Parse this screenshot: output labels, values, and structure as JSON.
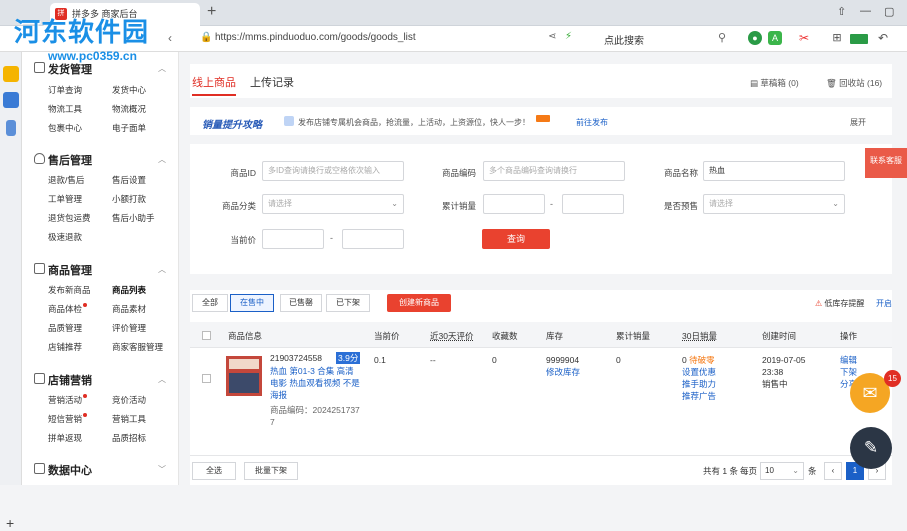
{
  "browser": {
    "tab_title": "拼多多 商家后台",
    "new_tab": "+",
    "url": "https://mms.pinduoduo.com/goods/goods_list",
    "search_hint": "点此搜索",
    "win_pin": "⇧",
    "win_min": "—",
    "win_max": "▢"
  },
  "watermark": {
    "title": "河东软件园",
    "url": "www.pc0359.cn"
  },
  "sidebar": {
    "sections": [
      {
        "title": "发货管理",
        "items": [
          "订单查询",
          "发货中心",
          "物流工具",
          "物流概况",
          "包裹中心",
          "电子面单"
        ]
      },
      {
        "title": "售后管理",
        "items": [
          "退款/售后",
          "售后设置",
          "工单管理",
          "小额打款",
          "退货包运费",
          "售后小助手",
          "极速退款"
        ]
      },
      {
        "title": "商品管理",
        "items": [
          "发布新商品",
          "商品列表",
          "商品体检",
          "商品素材",
          "品质管理",
          "评价管理",
          "店铺推荐",
          "商家客服管理"
        ]
      },
      {
        "title": "店铺营销",
        "items": [
          "营销活动",
          "竞价活动",
          "短信营销",
          "营销工具",
          "拼单返现",
          "品质招标"
        ]
      },
      {
        "title": "数据中心",
        "items": []
      }
    ]
  },
  "tabs": {
    "online": "线上商品",
    "upload": "上传记录",
    "draft": "草稿箱 (0)",
    "recycle": "回收站 (16)"
  },
  "promo": {
    "title": "销量提升攻略",
    "text": "发布店铺专属机会商品，抢流量，上活动，上资源位，快人一步！",
    "link": "前往发布",
    "expand": "展开"
  },
  "filters": {
    "id_label": "商品ID",
    "id_placeholder": "多ID查询请换行或空格依次输入",
    "code_label": "商品编码",
    "code_placeholder": "多个商品编码查询请换行",
    "name_label": "商品名称",
    "name_value": "热血",
    "category_label": "商品分类",
    "category_placeholder": "请选择",
    "sales_label": "累计销量",
    "presale_label": "是否预售",
    "presale_placeholder": "请选择",
    "price_label": "当前价",
    "dash": "-",
    "search_button": "查询"
  },
  "status_tabs": [
    "全部",
    "在售中",
    "已售罄",
    "已下架"
  ],
  "create_button": "创建新商品",
  "low_stock": {
    "label": "低库存提醒",
    "toggle": "开启"
  },
  "table": {
    "headers": [
      "商品信息",
      "当前价",
      "近30天评价",
      "收藏数",
      "库存",
      "累计销量",
      "30日销量",
      "创建时间",
      "操作"
    ],
    "row": {
      "id": "21903724558",
      "price_tag": "3.9分",
      "title": "热血 第01-3 合集 高清电影 热血观看视频 不是海报",
      "code": "商品编码：2024251737 7",
      "price": "0.1",
      "reviews": "--",
      "favorites": "0",
      "stock": "9999904",
      "stock_edit": "修改库存",
      "total_sales": "0",
      "sales30": "0",
      "sales30_status": "待破零",
      "sales30_a1": "设置优惠",
      "sales30_a2": "推手助力",
      "sales30_a3": "推荐广告",
      "created_date": "2019-07-05",
      "created_time": "23:38",
      "created_status": "销售中",
      "op1": "编辑",
      "op2": "下架",
      "op3": "分享"
    }
  },
  "bottom": {
    "select_all": "全选",
    "bulk_off": "批量下架",
    "total": "共有 1 条",
    "per_page_label": "每页",
    "per_page": "10",
    "per_page_unit": "条",
    "page": "1"
  },
  "float": {
    "service": "联系客服",
    "badge": "15"
  }
}
